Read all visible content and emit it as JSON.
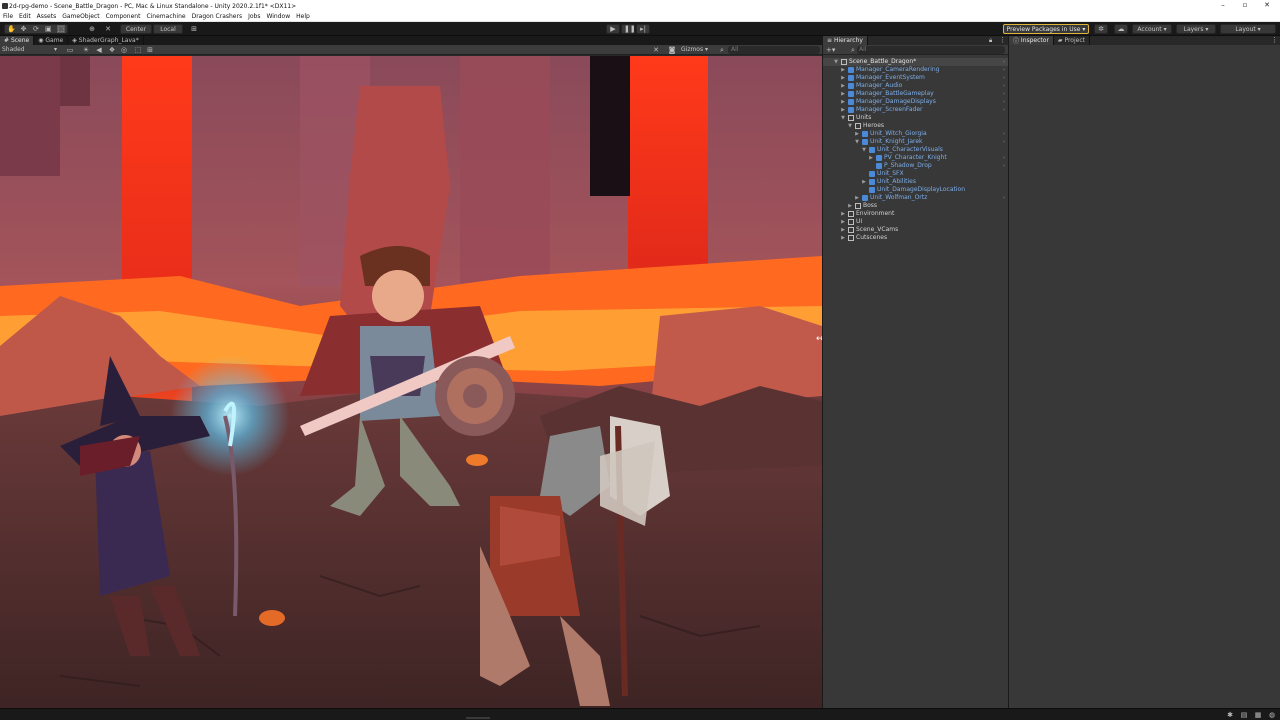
{
  "window": {
    "title": "2d-rpg-demo - Scene_Battle_Dragon - PC, Mac & Linux Standalone - Unity 2020.2.1f1* <DX11>",
    "minimize": "–",
    "maximize": "▫",
    "close": "✕"
  },
  "menu": [
    "File",
    "Edit",
    "Assets",
    "GameObject",
    "Component",
    "Cinemachine",
    "Dragon Crashers",
    "Jobs",
    "Window",
    "Help"
  ],
  "toolbar": {
    "center_label": "Center",
    "local_label": "Local",
    "preview_packages": "Preview Packages in Use ▾",
    "account": "Account",
    "layers": "Layers",
    "layout": "Layout"
  },
  "scene_tabs": [
    "Scene",
    "Game",
    "ShaderGraph_Lava*"
  ],
  "scene_bar": {
    "shading": "Shaded",
    "gizmos": "Gizmos",
    "search_placeholder": "All"
  },
  "hierarchy": {
    "tab": "Hierarchy",
    "search_placeholder": "All",
    "rows": [
      {
        "label": "Scene_Battle_Dragon*",
        "depth": 0,
        "expanded": true,
        "kind": "scene",
        "has_arrow": true,
        "more": true
      },
      {
        "label": "Manager_CameraRendering",
        "depth": 1,
        "expanded": false,
        "kind": "prefab",
        "has_arrow": true,
        "more": true
      },
      {
        "label": "Manager_EventSystem",
        "depth": 1,
        "expanded": false,
        "kind": "prefab",
        "has_arrow": true,
        "more": true
      },
      {
        "label": "Manager_Audio",
        "depth": 1,
        "expanded": false,
        "kind": "prefab",
        "has_arrow": true,
        "more": true
      },
      {
        "label": "Manager_BattleGameplay",
        "depth": 1,
        "expanded": false,
        "kind": "prefab",
        "has_arrow": true,
        "more": true
      },
      {
        "label": "Manager_DamageDisplays",
        "depth": 1,
        "expanded": false,
        "kind": "prefab",
        "has_arrow": true,
        "more": true
      },
      {
        "label": "Manager_ScreenFader",
        "depth": 1,
        "expanded": false,
        "kind": "prefab",
        "has_arrow": true,
        "more": true
      },
      {
        "label": "Units",
        "depth": 1,
        "expanded": true,
        "kind": "object",
        "has_arrow": true,
        "more": false
      },
      {
        "label": "Heroes",
        "depth": 2,
        "expanded": true,
        "kind": "object",
        "has_arrow": true,
        "more": false
      },
      {
        "label": "Unit_Witch_Giorgia",
        "depth": 3,
        "expanded": false,
        "kind": "prefab",
        "has_arrow": true,
        "more": true
      },
      {
        "label": "Unit_Knight_Jarek",
        "depth": 3,
        "expanded": true,
        "kind": "prefab",
        "has_arrow": true,
        "more": true
      },
      {
        "label": "Unit_CharacterVisuals",
        "depth": 4,
        "expanded": true,
        "kind": "prefab",
        "has_arrow": true,
        "more": false
      },
      {
        "label": "PV_Character_Knight",
        "depth": 5,
        "expanded": false,
        "kind": "prefab",
        "has_arrow": true,
        "more": true
      },
      {
        "label": "P_Shadow_Drop",
        "depth": 5,
        "expanded": false,
        "kind": "prefab",
        "has_arrow": false,
        "more": true
      },
      {
        "label": "Unit_SFX",
        "depth": 4,
        "expanded": false,
        "kind": "prefab",
        "has_arrow": false,
        "more": false
      },
      {
        "label": "Unit_Abilities",
        "depth": 4,
        "expanded": false,
        "kind": "prefab",
        "has_arrow": true,
        "more": false
      },
      {
        "label": "Unit_DamageDisplayLocation",
        "depth": 4,
        "expanded": false,
        "kind": "prefab",
        "has_arrow": false,
        "more": false
      },
      {
        "label": "Unit_Wolfman_Ortz",
        "depth": 3,
        "expanded": false,
        "kind": "prefab",
        "has_arrow": true,
        "more": true
      },
      {
        "label": "Boss",
        "depth": 2,
        "expanded": false,
        "kind": "object",
        "has_arrow": true,
        "more": false
      },
      {
        "label": "Environment",
        "depth": 1,
        "expanded": false,
        "kind": "object",
        "has_arrow": true,
        "more": false
      },
      {
        "label": "UI",
        "depth": 1,
        "expanded": false,
        "kind": "object",
        "has_arrow": true,
        "more": false
      },
      {
        "label": "Scene_VCams",
        "depth": 1,
        "expanded": false,
        "kind": "object",
        "has_arrow": true,
        "more": false
      },
      {
        "label": "Cutscenes",
        "depth": 1,
        "expanded": false,
        "kind": "object",
        "has_arrow": true,
        "more": false
      }
    ]
  },
  "inspector_tabs": [
    "Inspector",
    "Project"
  ],
  "colors": {
    "prefab_text": "#7caeea",
    "lava": "#ff5a1a",
    "panel": "#383838"
  }
}
